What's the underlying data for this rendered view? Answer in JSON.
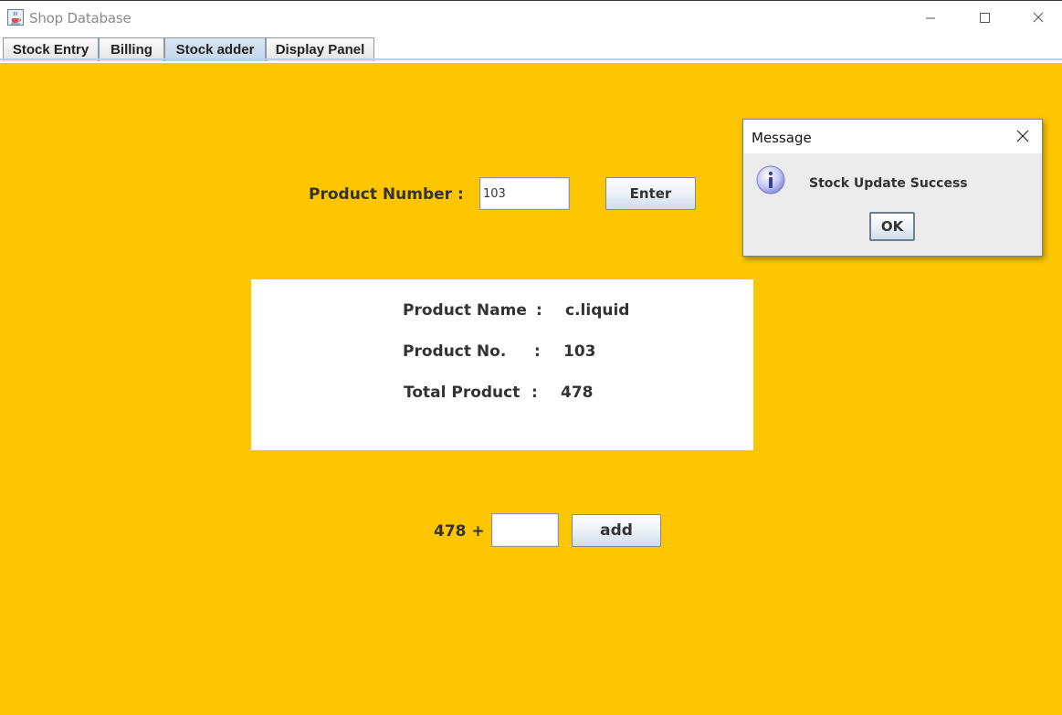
{
  "window": {
    "title": "Shop Database"
  },
  "tabs": [
    {
      "label": "Stock Entry"
    },
    {
      "label": "Billing"
    },
    {
      "label": "Stock adder",
      "active": true
    },
    {
      "label": "Display Panel"
    }
  ],
  "form": {
    "product_number_label": "Product Number :",
    "product_number_value": "103",
    "enter_label": "Enter"
  },
  "details": {
    "name_label": "Product Name",
    "name_colon": ":",
    "name_value": "c.liquid",
    "no_label": "Product No.",
    "no_colon": ":",
    "no_value": "103",
    "total_label": "Total Product",
    "total_colon": ":",
    "total_value": "478"
  },
  "adder": {
    "prefix": "478 +",
    "value": "",
    "add_label": "add"
  },
  "dialog": {
    "title": "Message",
    "message": "Stock Update Success",
    "ok_label": "OK"
  },
  "colors": {
    "panel_background": "#fec601",
    "active_tab": "#c3d6ea",
    "info_icon": "#8d8fe0"
  },
  "icons": {
    "app": "java-coffee-icon",
    "minimize": "minimize-icon",
    "maximize": "maximize-icon",
    "close": "close-icon",
    "dialog_close": "close-icon",
    "message": "info-icon"
  }
}
